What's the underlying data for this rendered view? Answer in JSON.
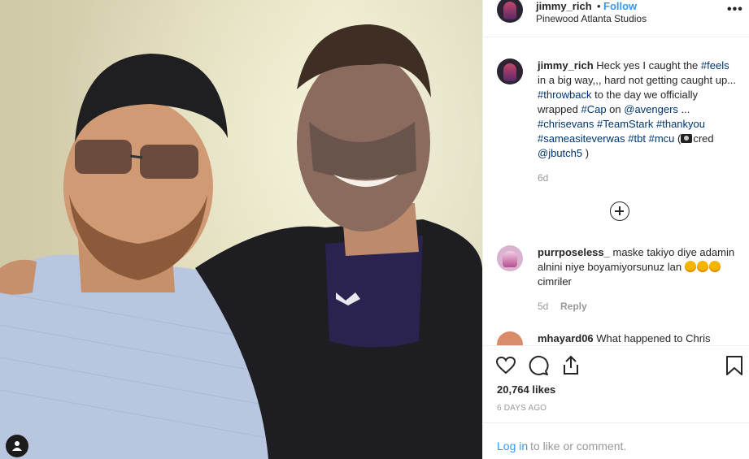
{
  "post": {
    "username": "jimmy_rich",
    "follow_label": "Follow",
    "separator": "•",
    "location": "Pinewood Atlanta Studios",
    "more_label": "•••"
  },
  "caption": {
    "username": "jimmy_rich",
    "segments": [
      {
        "text": "Heck yes I caught the ",
        "tag": false
      },
      {
        "text": "#feels",
        "tag": true
      },
      {
        "text": " in a big way,,, hard not getting caught up... ",
        "tag": false
      },
      {
        "text": "#throwback",
        "tag": true
      },
      {
        "text": " to the day we officially wrapped ",
        "tag": false
      },
      {
        "text": "#Cap",
        "tag": true
      },
      {
        "text": " on ",
        "tag": false
      },
      {
        "text": "@avengers",
        "tag": true
      },
      {
        "text": " ... ",
        "tag": false
      },
      {
        "text": "#chrisevans",
        "tag": true
      },
      {
        "text": " ",
        "tag": false
      },
      {
        "text": "#TeamStark",
        "tag": true
      },
      {
        "text": " ",
        "tag": false
      },
      {
        "text": "#thankyou",
        "tag": true
      },
      {
        "text": " ",
        "tag": false
      },
      {
        "text": "#sameasiteverwas",
        "tag": true
      },
      {
        "text": " ",
        "tag": false
      },
      {
        "text": "#tbt",
        "tag": true
      },
      {
        "text": " ",
        "tag": false
      },
      {
        "text": "#mcu",
        "tag": true
      },
      {
        "text": " (",
        "tag": false
      },
      {
        "text": "",
        "camera": true
      },
      {
        "text": "cred ",
        "tag": false
      },
      {
        "text": "@jbutch5",
        "tag": true
      },
      {
        "text": " )",
        "tag": false
      }
    ],
    "age": "6d"
  },
  "comments": [
    {
      "username": "purrposeless_",
      "text_before": "maske takiyo diye adamin alnini niye boyamiyorsunuz lan",
      "emoji_count": 3,
      "text_after": "cimriler",
      "age": "5d",
      "reply_label": "Reply"
    },
    {
      "username": "mhayard06",
      "text_before": "What happened to Chris"
    }
  ],
  "actions": {
    "likes": "20,764 likes",
    "timestamp": "6 DAYS AGO"
  },
  "login": {
    "link": "Log in",
    "rest": "to like or comment."
  },
  "colors": {
    "accent": "#3897f0",
    "hashtag": "#003569",
    "muted": "#999999"
  },
  "icons": [
    "heart-icon",
    "comment-icon",
    "share-icon",
    "bookmark-icon",
    "plus-circle-icon",
    "user-tag-icon",
    "more-icon"
  ]
}
